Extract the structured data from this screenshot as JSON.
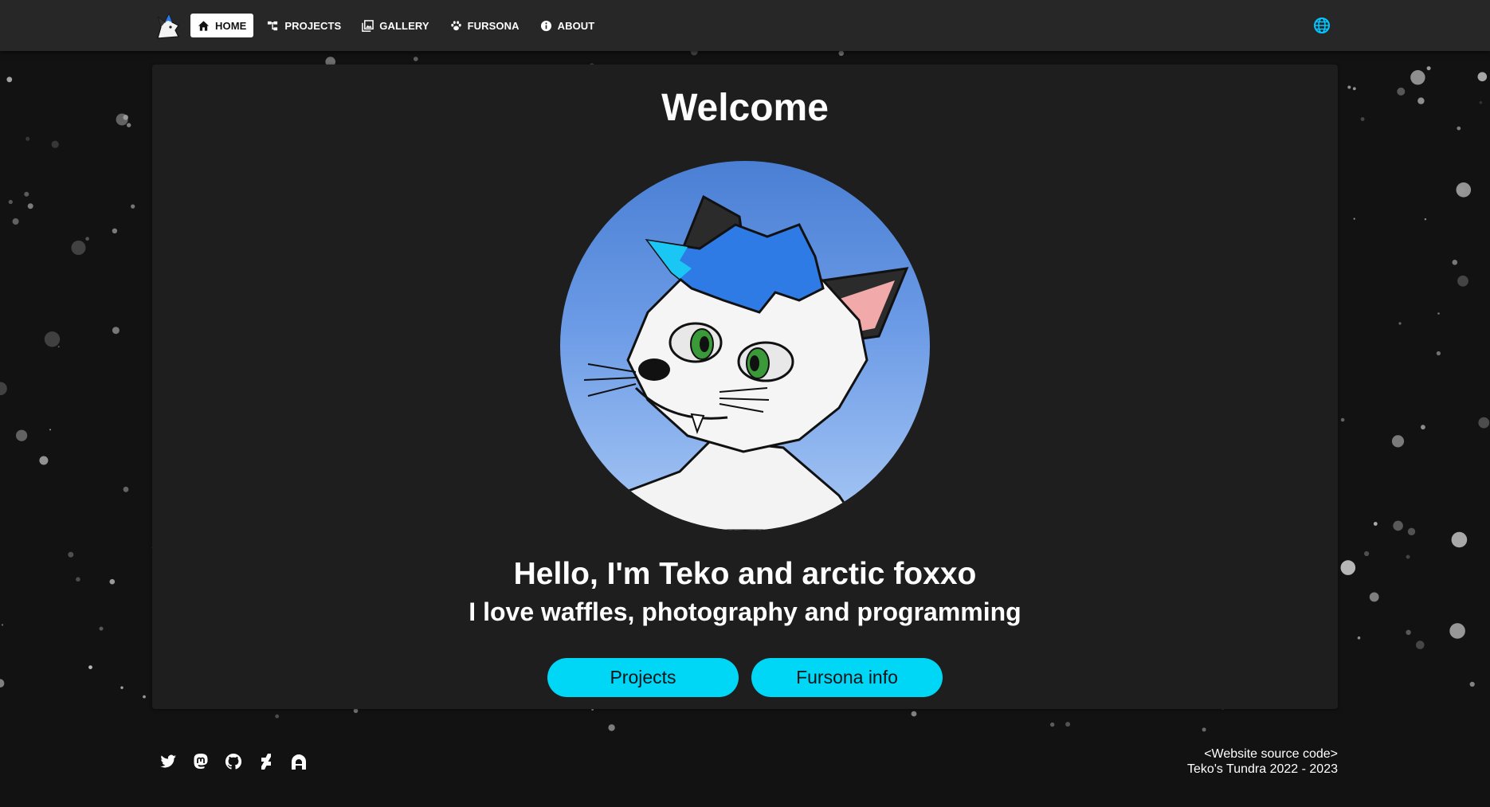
{
  "nav": {
    "items": [
      {
        "label": "HOME",
        "icon": "home-icon",
        "active": true
      },
      {
        "label": "PROJECTS",
        "icon": "sitemap-icon",
        "active": false
      },
      {
        "label": "GALLERY",
        "icon": "image-stack-icon",
        "active": false
      },
      {
        "label": "FURSONA",
        "icon": "paw-icon",
        "active": false
      },
      {
        "label": "ABOUT",
        "icon": "info-icon",
        "active": false
      }
    ],
    "language_icon": "globe-icon",
    "accent_color": "#00d6f5"
  },
  "main": {
    "title": "Welcome",
    "headline": "Hello, I'm Teko and arctic foxxo",
    "subline": "I love waffles, photography and programming",
    "buttons": {
      "projects": "Projects",
      "fursona": "Fursona info"
    }
  },
  "footer": {
    "social_icons": [
      "twitter-icon",
      "mastodon-icon",
      "github-icon",
      "deviantart-icon",
      "furaffinity-icon"
    ],
    "source_link": "<Website source code>",
    "copyright": "Teko's Tundra 2022 - 2023"
  }
}
